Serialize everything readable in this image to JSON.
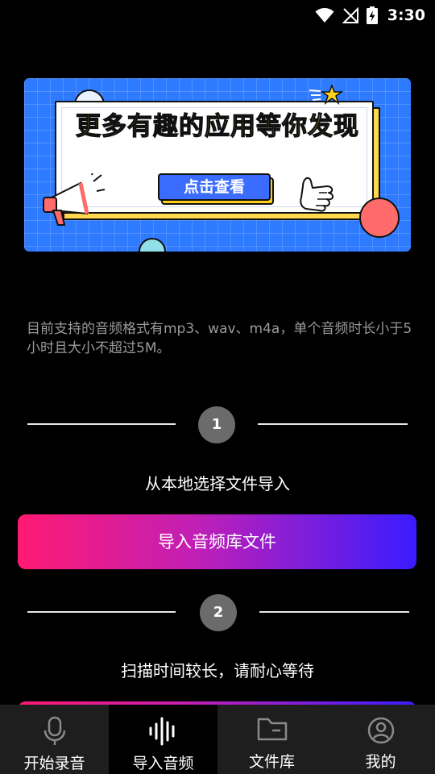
{
  "status_bar": {
    "time": "3:30",
    "icons": [
      "wifi-icon",
      "no-signal-icon",
      "battery-charging-icon"
    ]
  },
  "banner": {
    "title": "更多有趣的应用等你发现",
    "button_label": "点击查看",
    "colors": {
      "background": "#2f7bff",
      "title": "#ffd21c",
      "button": "#3a6cff"
    }
  },
  "info": {
    "text": "目前支持的音频格式有mp3、wav、m4a，单个音频时长小于5小时且大小不超过5M。"
  },
  "steps": [
    {
      "number": "1",
      "title": "从本地选择文件导入",
      "button_label": "导入音频库文件"
    },
    {
      "number": "2",
      "title": "扫描时间较长，请耐心等待",
      "button_label": ""
    }
  ],
  "bottom_nav": {
    "items": [
      {
        "label": "开始录音",
        "icon": "microphone-icon",
        "active": false
      },
      {
        "label": "导入音频",
        "icon": "audio-wave-icon",
        "active": true
      },
      {
        "label": "文件库",
        "icon": "folder-icon",
        "active": false
      },
      {
        "label": "我的",
        "icon": "person-icon",
        "active": false
      }
    ]
  },
  "colors": {
    "button_gradient_start": "#ff1a73",
    "button_gradient_end": "#3a1cff",
    "step_circle": "#6b6b6b",
    "info_text": "#9a9a9a"
  }
}
